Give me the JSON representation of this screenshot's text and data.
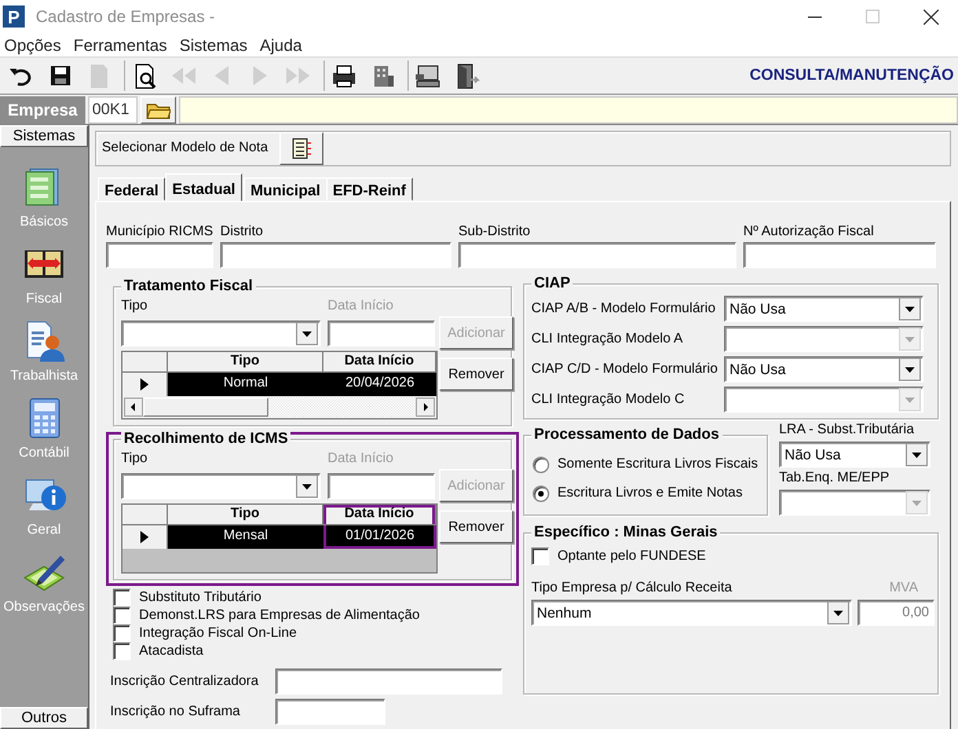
{
  "window": {
    "icon_text": "P",
    "title": "Cadastro de Empresas -"
  },
  "menu": [
    {
      "label": "Opções"
    },
    {
      "label": "Ferramentas"
    },
    {
      "label": "Sistemas"
    },
    {
      "label": "Ajuda"
    }
  ],
  "toolbar": {
    "groups": [
      [
        {
          "kind": "undo",
          "disabled": false
        },
        {
          "kind": "save",
          "disabled": false
        },
        {
          "kind": "document",
          "disabled": true
        }
      ],
      [
        {
          "kind": "preview",
          "disabled": false
        },
        {
          "kind": "first",
          "disabled": true
        },
        {
          "kind": "prev",
          "disabled": true
        },
        {
          "kind": "next",
          "disabled": true
        },
        {
          "kind": "last",
          "disabled": true
        }
      ],
      [
        {
          "kind": "print",
          "disabled": false
        },
        {
          "kind": "building",
          "disabled": false
        }
      ],
      [
        {
          "kind": "computer",
          "disabled": false
        },
        {
          "kind": "exit",
          "disabled": false
        }
      ]
    ],
    "mode": "CONSULTA/MANUTENÇÃO"
  },
  "company": {
    "label": "Empresa",
    "code": "00K1"
  },
  "sidebar": {
    "header": "Sistemas",
    "items": [
      {
        "label": "Básicos",
        "kind": "folder"
      },
      {
        "label": "Fiscal",
        "kind": "book"
      },
      {
        "label": "Trabalhista",
        "kind": "person"
      },
      {
        "label": "Contábil",
        "kind": "calculator"
      },
      {
        "label": "Geral",
        "kind": "info"
      },
      {
        "label": "Observações",
        "kind": "pen"
      }
    ],
    "footer": "Outros"
  },
  "note_model": {
    "label": "Selecionar Modelo de Nota"
  },
  "tabs": [
    {
      "label": "Federal",
      "selected": false
    },
    {
      "label": "Estadual",
      "selected": true
    },
    {
      "label": "Municipal",
      "selected": false
    },
    {
      "label": "EFD-Reinf",
      "selected": false
    }
  ],
  "fields": [
    {
      "label": "Município RICMS"
    },
    {
      "label": "Distrito"
    },
    {
      "label": "Sub-Distrito"
    },
    {
      "label": "Nº Autorização Fiscal"
    }
  ],
  "tratamento_fiscal": {
    "title": "Tratamento Fiscal",
    "tipo_label": "Tipo",
    "date": {
      "label": "Data Início",
      "disabled": true
    },
    "add_button": {
      "label": "Adicionar",
      "disabled": true
    },
    "remove_button": {
      "label": "Remover",
      "disabled": false
    },
    "scrollbar": true,
    "columns": [
      {
        "label": "Tipo",
        "highlighted": false
      },
      {
        "label": "Data Início",
        "highlighted": false
      }
    ],
    "rows": [
      {
        "cells": [
          "Normal",
          "20/04/2026"
        ],
        "selected": true
      }
    ]
  },
  "recolhimento_icms": {
    "title": "Recolhimento de ICMS",
    "highlighted": true,
    "tipo_label": "Tipo",
    "date": {
      "label": "Data Início",
      "disabled": true
    },
    "add_button": {
      "label": "Adicionar",
      "disabled": true
    },
    "remove_button": {
      "label": "Remover",
      "disabled": false
    },
    "scrollbar": false,
    "columns": [
      {
        "label": "Tipo",
        "highlighted": false
      },
      {
        "label": "Data Início",
        "highlighted": true
      }
    ],
    "rows": [
      {
        "cells": [
          "Mensal",
          "01/01/2026"
        ],
        "selected": true
      }
    ]
  },
  "checkboxes": [
    {
      "label": "Substituto Tributário",
      "checked": false
    },
    {
      "label": "Demonst.LRS para Empresas de Alimentação",
      "checked": false
    },
    {
      "label": "Integração Fiscal On-Line",
      "checked": false
    },
    {
      "label": "Atacadista",
      "checked": false
    }
  ],
  "inscricoes": [
    {
      "label": "Inscrição Centralizadora"
    },
    {
      "label": "Inscrição no Suframa"
    }
  ],
  "ciap": {
    "title": "CIAP",
    "rows": [
      {
        "label": "CIAP  A/B - Modelo Formulário",
        "value": "Não Usa",
        "disabled": false
      },
      {
        "label": "CLI Integração Modelo A",
        "disabled": true
      },
      {
        "label": "CIAP C/D - Modelo Formulário",
        "value": "Não Usa",
        "disabled": false
      },
      {
        "label": "CLI Integração Modelo C",
        "disabled": true
      }
    ]
  },
  "processamento": {
    "title": "Processamento de Dados",
    "options": [
      {
        "label": "Somente Escritura Livros Fiscais",
        "selected": false
      },
      {
        "label": "Escritura Livros e Emite Notas",
        "selected": true
      }
    ]
  },
  "lra": {
    "label": "LRA - Subst.Tributária",
    "value": "Não Usa",
    "disabled": false
  },
  "tab_enq": {
    "label": "Tab.Enq. ME/EPP",
    "disabled": true
  },
  "especifico": {
    "title": "Específico : Minas Gerais",
    "fundese": {
      "label": "Optante pelo FUNDESE",
      "checked": false
    },
    "tipo_empresa": {
      "label": "Tipo Empresa p/ Cálculo Receita",
      "value": "Nenhum",
      "disabled": false
    },
    "mva": {
      "label": "MVA",
      "value": "0,00",
      "disabled": true
    }
  }
}
